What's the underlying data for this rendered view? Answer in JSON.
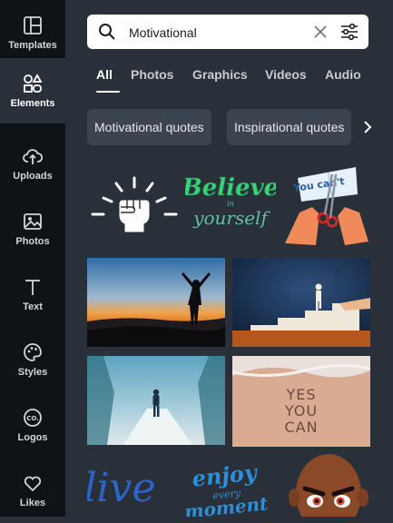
{
  "rail": {
    "items": [
      {
        "label": "Templates",
        "icon": "templates-icon"
      },
      {
        "label": "Elements",
        "icon": "elements-icon",
        "active": true
      },
      {
        "label": "Uploads",
        "icon": "uploads-icon"
      },
      {
        "label": "Photos",
        "icon": "photos-icon"
      },
      {
        "label": "Text",
        "icon": "text-icon"
      },
      {
        "label": "Styles",
        "icon": "styles-icon"
      },
      {
        "label": "Logos",
        "icon": "logos-icon"
      },
      {
        "label": "Likes",
        "icon": "heart-icon"
      }
    ]
  },
  "search": {
    "value": "Motivational",
    "icons": [
      "search-icon",
      "clear-icon",
      "filter-icon"
    ]
  },
  "tabs": [
    {
      "label": "All",
      "active": true
    },
    {
      "label": "Photos"
    },
    {
      "label": "Graphics"
    },
    {
      "label": "Videos"
    },
    {
      "label": "Audio"
    }
  ],
  "chips": [
    "Motivational quotes",
    "Inspirational quotes"
  ],
  "graphics": {
    "believe_line1": "Believe",
    "believe_small": "in",
    "believe_line2": "yourself",
    "you_cant": "You can't",
    "yes_you_can": [
      "YES",
      "YOU",
      "CAN"
    ],
    "live": "live",
    "enjoy": [
      "enjoy",
      "every",
      "moment"
    ]
  },
  "colors": {
    "bg": "#293039",
    "rail": "#0e1318",
    "chip": "#3c4450",
    "believe_green": "#3dd07a",
    "believe_teal": "#5fbfa6",
    "live_blue": "#2a64c8",
    "enjoy_blue": "#2c8fd8"
  }
}
